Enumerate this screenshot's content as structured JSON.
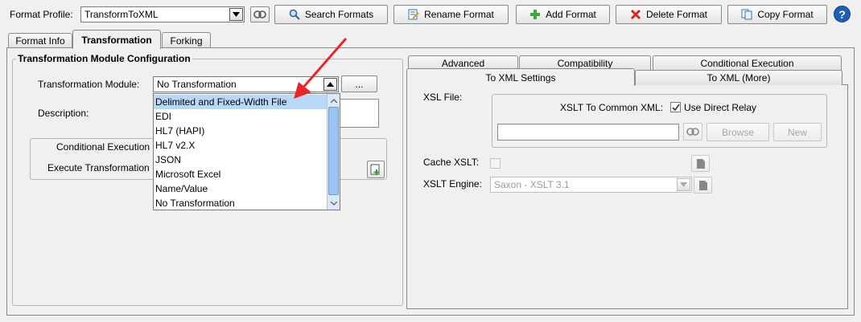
{
  "profile": {
    "label": "Format Profile:",
    "value": "TransformToXML"
  },
  "toolbar": {
    "search": "Search Formats",
    "rename": "Rename Format",
    "add": "Add Format",
    "delete": "Delete Format",
    "copy": "Copy Format",
    "help": "?"
  },
  "tabs": [
    "Format Info",
    "Transformation",
    "Forking"
  ],
  "left": {
    "group_title": "Transformation Module Configuration",
    "module_label": "Transformation Module:",
    "module_value": "No Transformation",
    "ellipsis": "...",
    "description_label": "Description:",
    "cond_exec_label": "Conditional Execution",
    "execute_label": "Execute Transformation",
    "dropdown_options": [
      "Delimited and Fixed-Width File",
      "EDI",
      "HL7 (HAPI)",
      "HL7 v2.X",
      "JSON",
      "Microsoft Excel",
      "Name/Value",
      "No Transformation"
    ],
    "highlighted_index": 0
  },
  "right": {
    "tabs_back": [
      "Advanced",
      "Compatibility",
      "Conditional Execution"
    ],
    "tabs_front": [
      "To XML Settings",
      "To XML (More)"
    ],
    "xsl_file_label": "XSL File:",
    "xslt_common_label": "XSLT To Common XML:",
    "use_direct_relay": "Use Direct Relay",
    "browse": "Browse",
    "new": "New",
    "cache_label": "Cache XSLT:",
    "engine_label": "XSLT Engine:",
    "engine_value": "Saxon - XSLT 3.1"
  },
  "colors": {
    "accent_highlight": "#b8d8f8",
    "arrow_red": "#e8262a",
    "help_blue": "#1c5fb8"
  }
}
